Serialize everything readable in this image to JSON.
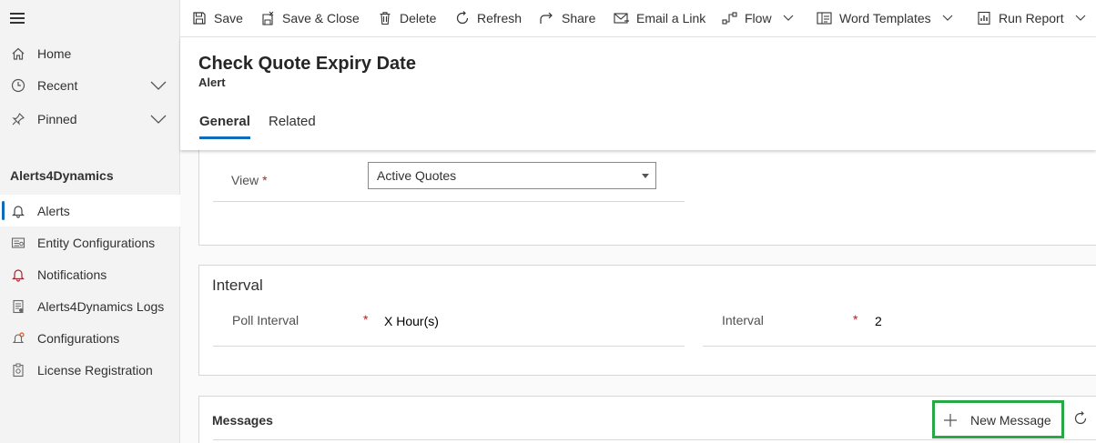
{
  "sidebar": {
    "area_title": "Alerts4Dynamics",
    "top_items": [
      {
        "label": "Home",
        "icon": "home-icon"
      },
      {
        "label": "Recent",
        "icon": "clock-icon"
      },
      {
        "label": "Pinned",
        "icon": "pin-icon"
      }
    ],
    "items": [
      {
        "label": "Alerts",
        "icon": "bell-icon",
        "active": true
      },
      {
        "label": "Entity Configurations",
        "icon": "entity-config-icon"
      },
      {
        "label": "Notifications",
        "icon": "bell-icon"
      },
      {
        "label": "Alerts4Dynamics Logs",
        "icon": "log-icon"
      },
      {
        "label": "Configurations",
        "icon": "settings-bell-icon"
      },
      {
        "label": "License Registration",
        "icon": "license-icon"
      }
    ]
  },
  "toolbar": {
    "save": "Save",
    "save_close": "Save & Close",
    "delete": "Delete",
    "refresh": "Refresh",
    "share": "Share",
    "email_link": "Email a Link",
    "flow": "Flow",
    "word_templates": "Word Templates",
    "run_report": "Run Report"
  },
  "header": {
    "title": "Check Quote Expiry Date",
    "subtitle": "Alert",
    "tabs": [
      "General",
      "Related"
    ]
  },
  "form": {
    "view_label": "View",
    "view_value": "Active Quotes",
    "interval_section_title": "Interval",
    "poll_interval_label": "Poll Interval",
    "poll_interval_value": "X Hour(s)",
    "interval_label": "Interval",
    "interval_value": "2",
    "required_marker": "*"
  },
  "messages": {
    "title": "Messages",
    "new_button": "New Message"
  },
  "colors": {
    "accent": "#0f6cbd",
    "highlight_box": "#27a844",
    "required": "#a4262c"
  }
}
